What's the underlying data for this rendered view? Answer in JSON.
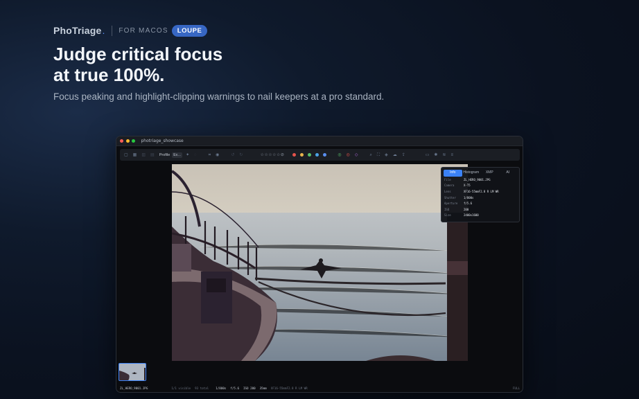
{
  "brand": {
    "name": "PhoTriage",
    "dot": ".",
    "platform": "FOR MACOS",
    "badge": "LOUPE"
  },
  "hero": {
    "headline_line1": "Judge critical focus",
    "headline_line2": "at true 100%.",
    "subhead": "Focus peaking and highlight-clipping warnings to nail keepers at a pro standard."
  },
  "window": {
    "title": "photriage_showcase",
    "toolbar": {
      "profile_label": "Profile",
      "profile_select": "Ex…",
      "stars": "☆☆☆☆☆⊘",
      "color_labels": [
        "#e5534b",
        "#e8b44b",
        "#57c06b",
        "#4ba3e8",
        "#5a8ff0"
      ]
    },
    "info_panel": {
      "tabs": [
        "Info",
        "Histogram",
        "XMP",
        "AI"
      ],
      "active_tab": "Info",
      "rows": [
        {
          "key": "File",
          "value": "ZL_HERO_9001.JPG"
        },
        {
          "key": "Camera",
          "value": "X-T5"
        },
        {
          "key": "Lens",
          "value": "XF16-55mmF2.8 R LM WR"
        },
        {
          "key": "Shutter",
          "value": "1/800s"
        },
        {
          "key": "Aperture",
          "value": "f/5.6"
        },
        {
          "key": "ISO",
          "value": "200"
        },
        {
          "key": "Size",
          "value": "2400x1600"
        }
      ]
    },
    "status": {
      "filename": "ZL_HERO_9001.JPG",
      "visible": "1/1 visible",
      "total": "93 total",
      "shutter": "1/800s",
      "aperture": "f/5.6",
      "iso": "ISO 200",
      "focal": "35mm",
      "lens": "XF16-55mmF2.8 R LM WR",
      "zoom": "FULL"
    }
  }
}
